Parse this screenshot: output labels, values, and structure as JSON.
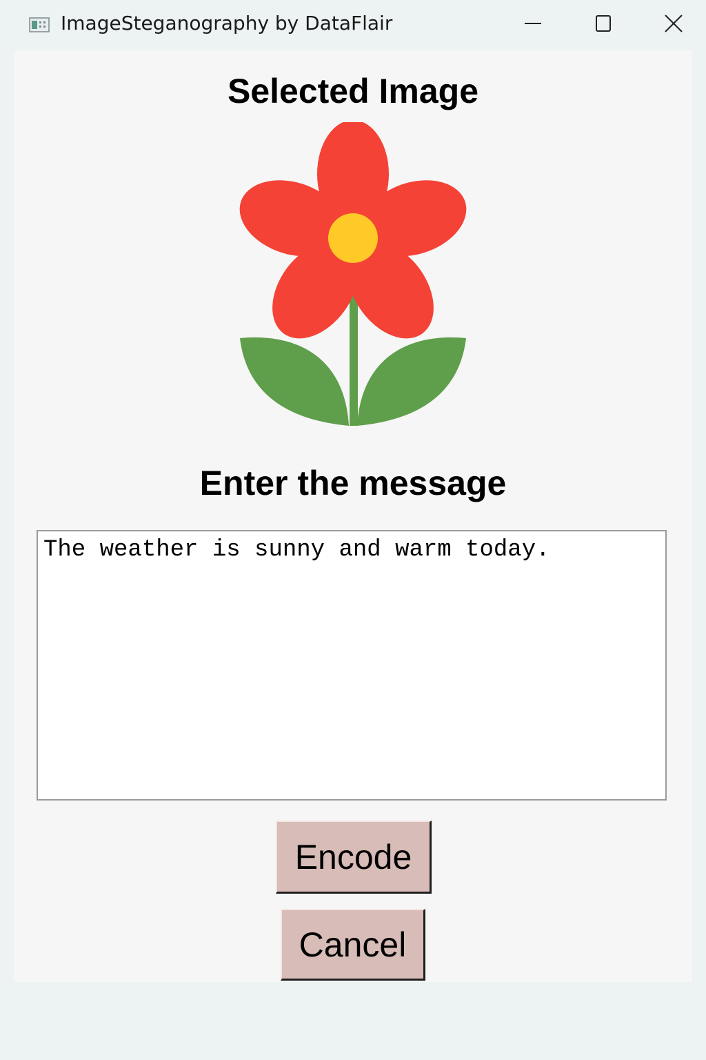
{
  "window": {
    "title": "ImageSteganography by DataFlair",
    "icon": "app-window-icon",
    "controls": [
      "minimize-icon",
      "maximize-icon",
      "close-icon"
    ]
  },
  "main": {
    "selected_image_heading": "Selected Image",
    "selected_image": "flower-icon",
    "message_heading": "Enter the message",
    "message_value": "The weather is sunny and warm today.",
    "encode_label": "Encode",
    "cancel_label": "Cancel"
  },
  "colors": {
    "petal": "#f44336",
    "center": "#ffca28",
    "stem_leaves": "#5f9e4a",
    "button_bg": "#d8bcb7"
  }
}
